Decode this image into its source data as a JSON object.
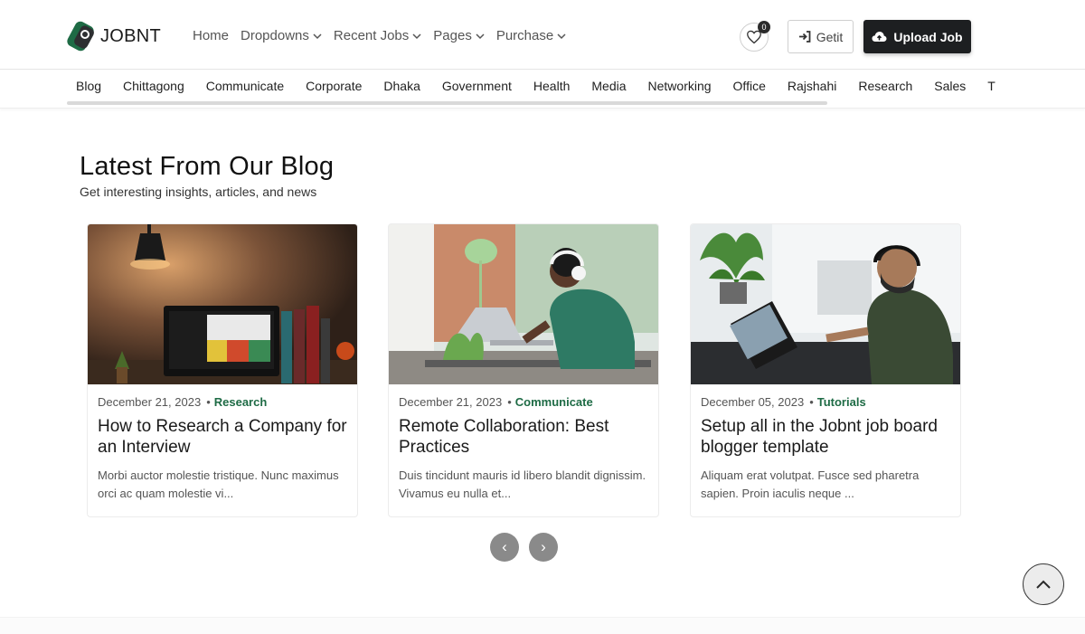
{
  "header": {
    "logo_text": "JOBNT",
    "nav": [
      {
        "label": "Home",
        "has_dropdown": false
      },
      {
        "label": "Dropdowns",
        "has_dropdown": true
      },
      {
        "label": "Recent Jobs",
        "has_dropdown": true
      },
      {
        "label": "Pages",
        "has_dropdown": true
      },
      {
        "label": "Purchase",
        "has_dropdown": true
      }
    ],
    "favorites_count": "0",
    "getit_label": "Getit",
    "upload_label": "Upload Job"
  },
  "categories": [
    "Blog",
    "Chittagong",
    "Communicate",
    "Corporate",
    "Dhaka",
    "Government",
    "Health",
    "Media",
    "Networking",
    "Office",
    "Rajshahi",
    "Research",
    "Sales",
    "T"
  ],
  "section": {
    "title": "Latest From Our Blog",
    "subtitle": "Get interesting insights, articles, and news"
  },
  "posts": [
    {
      "date": "December 21, 2023",
      "category": "Research",
      "title": "How to Research a Company for an Interview",
      "excerpt": "Morbi auctor molestie tristique. Nunc maximus orci ac quam molestie vi..."
    },
    {
      "date": "December 21, 2023",
      "category": "Communicate",
      "title": "Remote Collaboration: Best Practices",
      "excerpt": "Duis tincidunt mauris id libero blandit dignissim. Vivamus eu nulla et..."
    },
    {
      "date": "December 05, 2023",
      "category": "Tutorials",
      "title": "Setup all in the Jobnt job board blogger template",
      "excerpt": "Aliquam erat volutpat. Fusce sed pharetra sapien. Proin iaculis neque ..."
    }
  ],
  "pager": {
    "prev": "‹",
    "next": "›"
  },
  "colors": {
    "accent_green": "#1e6b45",
    "dark_button": "#1d1f21",
    "pager_gray": "#8a8a8a"
  }
}
